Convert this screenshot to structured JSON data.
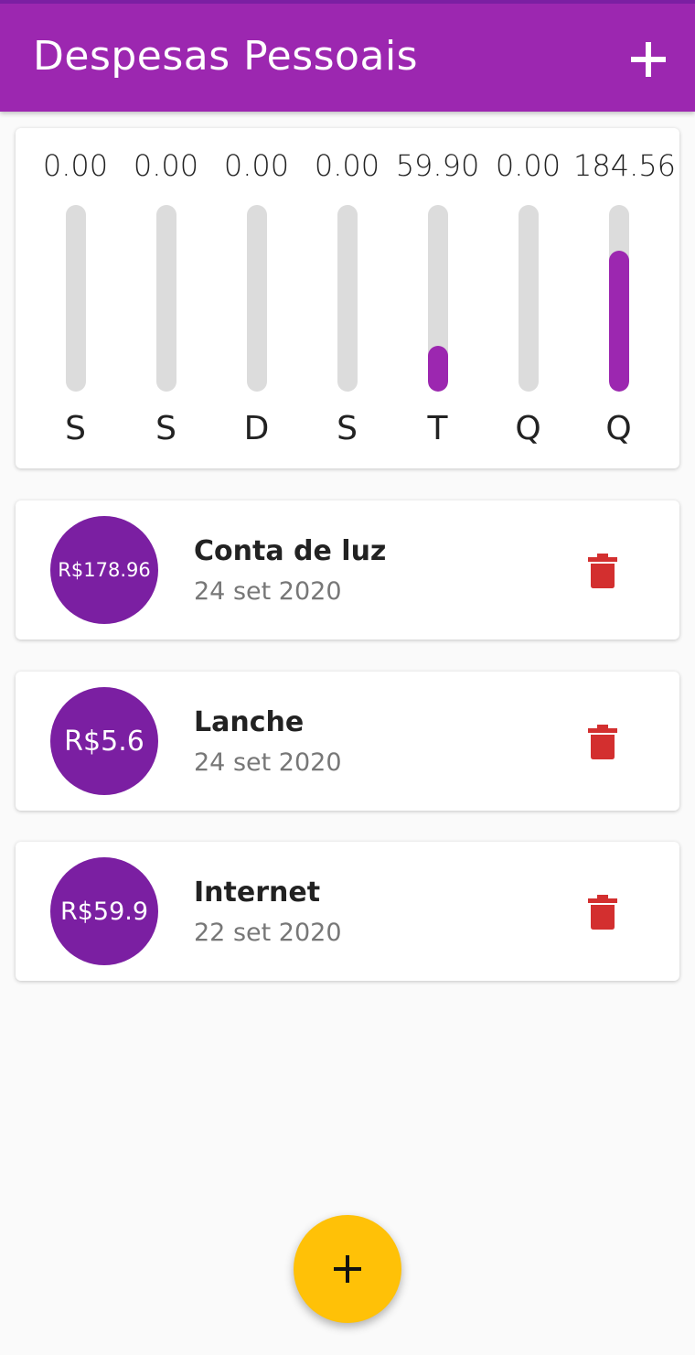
{
  "appbar": {
    "title": "Despesas Pessoais",
    "add_icon": "plus-icon"
  },
  "chart_data": {
    "type": "bar",
    "categories": [
      "S",
      "S",
      "D",
      "S",
      "T",
      "Q",
      "Q"
    ],
    "value_labels": [
      "0.00",
      "0.00",
      "0.00",
      "0.00",
      "59.90",
      "0.00",
      "184.56"
    ],
    "values": [
      0,
      0,
      0,
      0,
      59.9,
      0,
      184.56
    ],
    "fill_fractions": [
      0,
      0,
      0,
      0,
      0.245,
      0,
      0.755
    ],
    "colors": {
      "fill": "#9c27b0",
      "track": "#dcdcdc"
    }
  },
  "transactions": [
    {
      "amount": "R$178.96",
      "title": "Conta de luz",
      "date": "24 set 2020",
      "delete_icon": "trash-icon"
    },
    {
      "amount": "R$5.6",
      "title": "Lanche",
      "date": "24 set 2020",
      "delete_icon": "trash-icon"
    },
    {
      "amount": "R$59.9",
      "title": "Internet",
      "date": "22 set 2020",
      "delete_icon": "trash-icon"
    }
  ],
  "fab": {
    "icon": "plus-icon",
    "color": "#ffc107"
  },
  "colors": {
    "primary": "#9c27b0",
    "avatar": "#7b1fa2",
    "delete": "#d32f2f"
  }
}
